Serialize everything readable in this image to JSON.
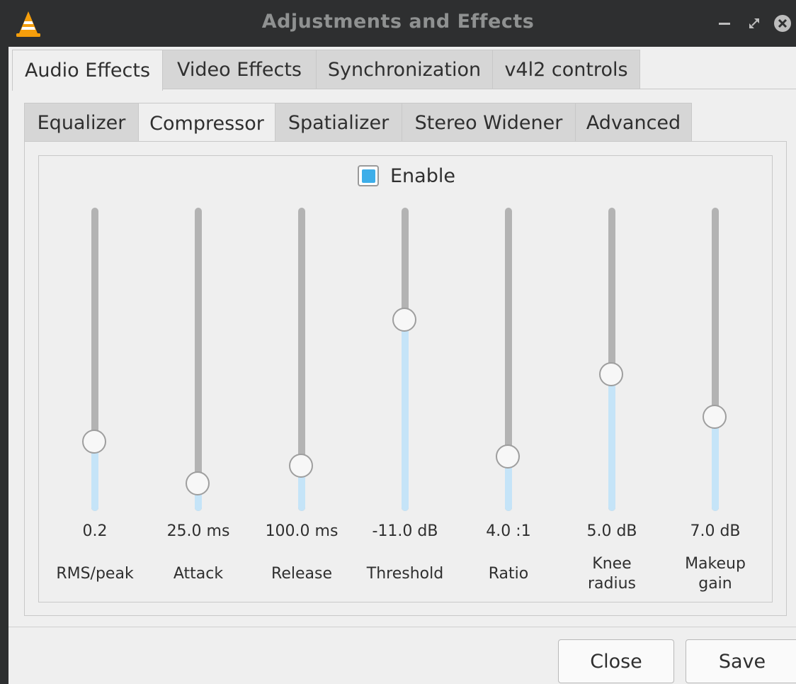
{
  "window": {
    "title": "Adjustments and Effects"
  },
  "main_tabs": [
    {
      "label": "Audio Effects",
      "active": true
    },
    {
      "label": "Video Effects",
      "active": false
    },
    {
      "label": "Synchronization",
      "active": false
    },
    {
      "label": "v4l2 controls",
      "active": false
    }
  ],
  "sub_tabs": [
    {
      "label": "Equalizer",
      "active": false
    },
    {
      "label": "Compressor",
      "active": true
    },
    {
      "label": "Spatializer",
      "active": false
    },
    {
      "label": "Stereo Widener",
      "active": false
    },
    {
      "label": "Advanced",
      "active": false
    }
  ],
  "compressor": {
    "enable_label": "Enable",
    "enabled": true,
    "sliders": [
      {
        "value": "0.2",
        "label": "RMS/peak",
        "level": 0.23
      },
      {
        "value": "25.0 ms",
        "label": "Attack",
        "level": 0.09
      },
      {
        "value": "100.0 ms",
        "label": "Release",
        "level": 0.15
      },
      {
        "value": "-11.0 dB",
        "label": "Threshold",
        "level": 0.63
      },
      {
        "value": "4.0 :1",
        "label": "Ratio",
        "level": 0.18
      },
      {
        "value": "5.0 dB",
        "label": "Knee\nradius",
        "level": 0.45
      },
      {
        "value": "7.0 dB",
        "label": "Makeup\ngain",
        "level": 0.31
      }
    ]
  },
  "buttons": {
    "close_label": "Close",
    "save_label": "Save"
  },
  "colors": {
    "accent": "#3daee9",
    "slider_fill": "#c5e4f8",
    "titlebar": "#2e2f30"
  },
  "icons": {
    "app": "vlc-cone-icon",
    "minimize": "minimize-icon",
    "maximize": "maximize-icon",
    "close": "close-icon"
  }
}
